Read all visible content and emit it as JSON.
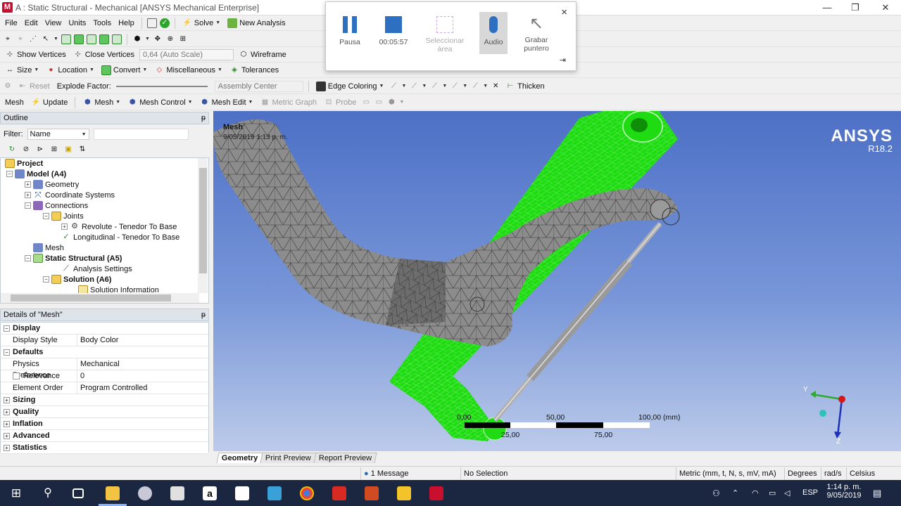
{
  "window": {
    "logo": "M",
    "title": "A : Static Structural - Mechanical [ANSYS Mechanical Enterprise]"
  },
  "menu": {
    "file": "File",
    "edit": "Edit",
    "view": "View",
    "units": "Units",
    "tools": "Tools",
    "help": "Help",
    "solve": "Solve",
    "new_analysis": "New Analysis"
  },
  "toolbar2": {
    "show_vertices": "Show Vertices",
    "close_vertices": "Close Vertices",
    "scale": "0,64 (Auto Scale)",
    "wireframe": "Wireframe"
  },
  "toolbar3": {
    "size": "Size",
    "location": "Location",
    "convert": "Convert",
    "miscellaneous": "Miscellaneous",
    "tolerances": "Tolerances"
  },
  "toolbar4": {
    "reset": "Reset",
    "explode_factor": "Explode Factor:",
    "assembly_center": "Assembly Center",
    "edge_coloring": "Edge Coloring",
    "thicken": "Thicken"
  },
  "toolbar5": {
    "mesh": "Mesh",
    "update": "Update",
    "mesh_btn": "Mesh",
    "mesh_control": "Mesh Control",
    "mesh_edit": "Mesh Edit",
    "metric_graph": "Metric Graph",
    "probe": "Probe"
  },
  "outline": {
    "header": "Outline",
    "pin": "ᵽ",
    "filter_label": "Filter:",
    "filter_value": "Name",
    "tree": [
      {
        "label": "Project",
        "bold": true
      },
      {
        "label": "Model (A4)",
        "bold": true
      },
      {
        "label": "Geometry"
      },
      {
        "label": "Coordinate Systems"
      },
      {
        "label": "Connections"
      },
      {
        "label": "Joints"
      },
      {
        "label": "Revolute - Tenedor To Base"
      },
      {
        "label": "Longitudinal - Tenedor To Base"
      },
      {
        "label": "Mesh"
      },
      {
        "label": "Static Structural (A5)",
        "bold": true
      },
      {
        "label": "Analysis Settings"
      },
      {
        "label": "Solution (A6)",
        "bold": true
      },
      {
        "label": "Solution Information"
      }
    ]
  },
  "details": {
    "header": "Details of \"Mesh\"",
    "pin": "ᵽ",
    "rows": [
      {
        "group": "Display"
      },
      {
        "key": "Display Style",
        "value": "Body Color"
      },
      {
        "group": "Defaults"
      },
      {
        "key": "Physics Preference",
        "value": "Mechanical"
      },
      {
        "key": "Relevance",
        "value": "0"
      },
      {
        "key": "Element Order",
        "value": "Program Controlled"
      },
      {
        "group": "Sizing"
      },
      {
        "group": "Quality"
      },
      {
        "group": "Inflation"
      },
      {
        "group": "Advanced"
      },
      {
        "group": "Statistics"
      }
    ]
  },
  "viewport": {
    "label": "Mesh",
    "timestamp": "9/05/2019 1:13 p. m.",
    "brand": "ANSYS",
    "version": "R18.2",
    "scale_ticks_top": [
      "0,00",
      "50,00",
      "100,00 (mm)"
    ],
    "scale_ticks_bottom": [
      "25,00",
      "75,00"
    ],
    "axes": {
      "y": "Y",
      "z": "Z"
    }
  },
  "tabs": [
    "Geometry",
    "Print Preview",
    "Report Preview"
  ],
  "status": {
    "messages": "1 Message",
    "selection": "No Selection",
    "units": "Metric (mm, t, N, s, mV, mA)",
    "degrees": "Degrees",
    "rads": "rad/s",
    "temp": "Celsius"
  },
  "recorder": {
    "pause": "Pausa",
    "time": "00:05:57",
    "select_area_1": "Seleccionar",
    "select_area_2": "área",
    "audio": "Audio",
    "record_pointer_1": "Grabar",
    "record_pointer_2": "puntero",
    "close": "×"
  },
  "taskbar": {
    "lang": "ESP",
    "time": "1:14 p. m.",
    "date": "9/05/2019"
  },
  "colors": {
    "accent_green": "#1fdc12",
    "mesh_gray": "#8c8c8c",
    "viewport_top": "#4d70c6",
    "ansys_red": "#c8102e"
  }
}
